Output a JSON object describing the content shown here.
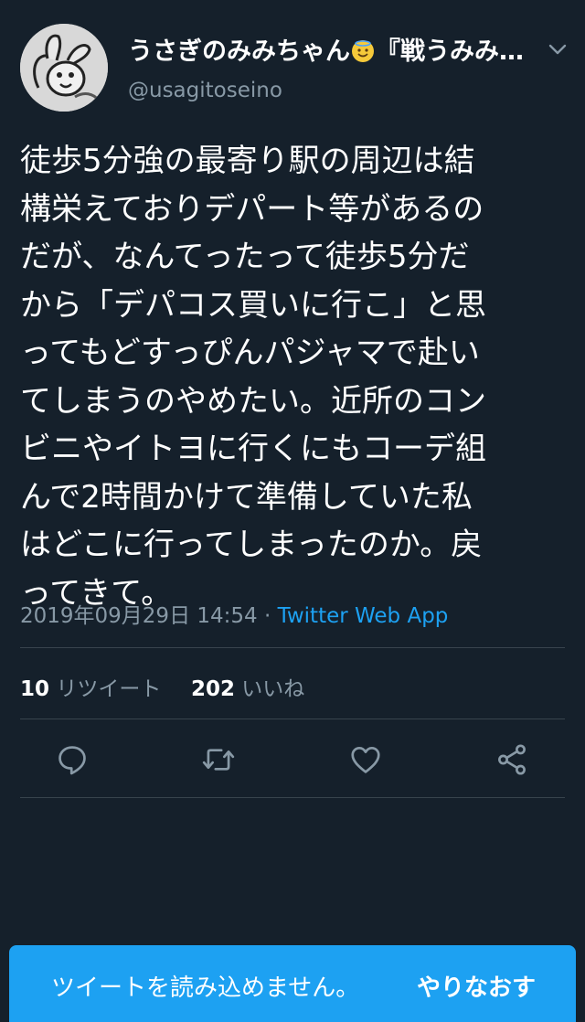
{
  "user": {
    "display_name": "うさぎのみみちゃん",
    "display_name_suffix": "『戦うみみ…",
    "handle": "@usagitoseino",
    "avatar_icon": "rabbit-drawing-avatar"
  },
  "tweet": {
    "text_lines": [
      "徒歩5分強の最寄り駅の周辺は結",
      "構栄えておりデパート等があるの",
      "だが、なんてったって徒歩5分だ",
      "から「デパコス買いに行こ」と思",
      "ってもどすっぴんパジャマで赴い",
      "てしまうのやめたい。近所のコン",
      "ビニやイトヨに行くにもコーデ組",
      "んで2時間かけて準備していた私",
      "はどこに行ってしまったのか。戻",
      "ってきて。"
    ],
    "timestamp": "2019年09月29日 14:54",
    "separator": " · ",
    "source_app": "Twitter Web App"
  },
  "stats": {
    "retweet_count": "10",
    "retweet_label": "リツイート",
    "like_count": "202",
    "like_label": "いいね"
  },
  "actions": [
    {
      "name": "reply",
      "icon": "speech-bubble-icon"
    },
    {
      "name": "retweet",
      "icon": "retweet-arrows-icon"
    },
    {
      "name": "like",
      "icon": "heart-icon"
    },
    {
      "name": "share",
      "icon": "share-nodes-icon"
    }
  ],
  "banner": {
    "message": "ツイートを読み込めません。",
    "retry_label": "やりなおす"
  },
  "colors": {
    "background": "#15202b",
    "accent": "#1da1f2",
    "secondary_text": "#8899a6",
    "divider": "#38444d"
  }
}
